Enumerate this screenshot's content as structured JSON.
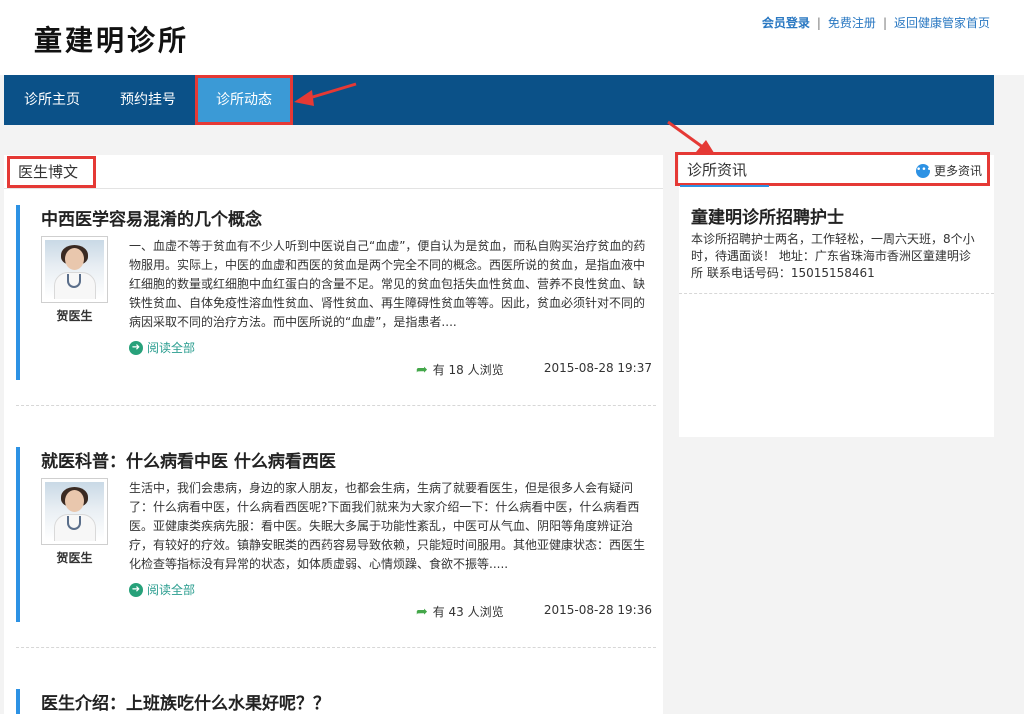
{
  "header": {
    "logo_text": "童建明诊所",
    "links": [
      "会员登录",
      "免费注册",
      "返回健康管家首页"
    ],
    "separator": "|"
  },
  "nav": {
    "items": [
      "诊所主页",
      "预约挂号",
      "诊所动态"
    ],
    "active_index": 2
  },
  "blog": {
    "section_title": "医生博文",
    "read_all_label": "阅读全部",
    "posts": [
      {
        "title": "中西医学容易混淆的几个概念",
        "author": "贺医生",
        "excerpt": "一、血虚不等于贫血有不少人听到中医说自己“血虚”，便自认为是贫血，而私自购买治疗贫血的药物服用。实际上，中医的血虚和西医的贫血是两个完全不同的概念。西医所说的贫血，是指血液中红细胞的数量或红细胞中血红蛋白的含量不足。常见的贫血包括失血性贫血、营养不良性贫血、缺铁性贫血、自体免疫性溶血性贫血、肾性贫血、再生障碍性贫血等等。因此，贫血必须针对不同的病因采取不同的治疗方法。而中医所说的“血虚”，是指患者....",
        "views": "有 18 人浏览",
        "date": "2015-08-28 19:37"
      },
      {
        "title": "就医科普：什么病看中医 什么病看西医",
        "author": "贺医生",
        "excerpt": "生活中，我们会患病，身边的家人朋友，也都会生病，生病了就要看医生，但是很多人会有疑问了：什么病看中医，什么病看西医呢?下面我们就来为大家介绍一下：什么病看中医，什么病看西医。亚健康类疾病先服：看中医。失眠大多属于功能性紊乱，中医可从气血、阴阳等角度辨证治疗，有较好的疗效。镇静安眠类的西药容易导致依赖，只能短时间服用。其他亚健康状态：西医生化检查等指标没有异常的状态，如体质虚弱、心情烦躁、食欲不振等.....",
        "views": "有 43 人浏览",
        "date": "2015-08-28 19:36"
      },
      {
        "title": "医生介绍：上班族吃什么水果好呢？？"
      }
    ]
  },
  "news": {
    "section_title": "诊所资讯",
    "more_label": "更多资讯",
    "items": [
      {
        "title": "童建明诊所招聘护士",
        "body": "本诊所招聘护士两名，工作轻松，一周六天班，8个小时，待遇面谈！ 地址：广东省珠海市香洲区童建明诊所 联系电话号码：15015158461"
      }
    ]
  },
  "colors": {
    "nav_bg": "#0b5188",
    "nav_active": "#3b9ad6",
    "highlight_red": "#e53935",
    "accent_blue": "#2d92e4",
    "link_blue": "#2a78c2"
  }
}
